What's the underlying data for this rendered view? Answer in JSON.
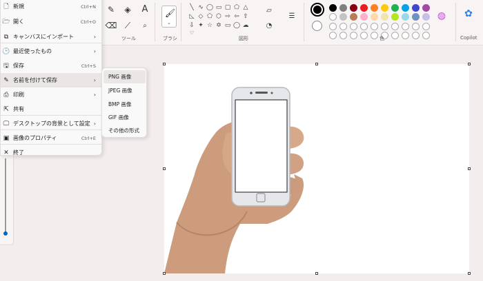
{
  "file_menu": {
    "items": [
      {
        "label": "新規",
        "shortcut": "Ctrl+N",
        "icon": "new-file-icon",
        "glyph": "🗋"
      },
      {
        "label": "開く",
        "shortcut": "Ctrl+O",
        "icon": "folder-open-icon",
        "glyph": "🗁"
      },
      {
        "label": "キャンバスにインポート",
        "shortcut": "",
        "arrow": "›",
        "icon": "import-icon",
        "glyph": "⧉"
      },
      {
        "label": "最近使ったもの",
        "shortcut": "",
        "arrow": "›",
        "icon": "clock-icon",
        "glyph": "🕒"
      },
      {
        "label": "保存",
        "shortcut": "Ctrl+S",
        "icon": "save-icon",
        "glyph": "🖫"
      },
      {
        "label": "名前を付けて保存",
        "shortcut": "",
        "arrow": "›",
        "icon": "save-as-icon",
        "glyph": "✎"
      },
      {
        "label": "印刷",
        "shortcut": "",
        "arrow": "›",
        "icon": "print-icon",
        "glyph": "⎙"
      },
      {
        "label": "共有",
        "shortcut": "",
        "icon": "share-icon",
        "glyph": "⇱"
      },
      {
        "label": "デスクトップの背景として設定",
        "shortcut": "",
        "arrow": "›",
        "icon": "desktop-icon",
        "glyph": "🖵"
      },
      {
        "label": "画像のプロパティ",
        "shortcut": "Ctrl+E",
        "icon": "properties-icon",
        "glyph": "▣"
      },
      {
        "label": "終了",
        "shortcut": "",
        "icon": "close-icon",
        "glyph": "✕"
      }
    ]
  },
  "save_as_submenu": [
    "PNG 画像",
    "JPEG 画像",
    "BMP 画像",
    "GIF 画像",
    "その他の形式"
  ],
  "ribbon": {
    "tools_label": "ツール",
    "brush_label": "ブラシ",
    "shapes_label": "図形",
    "colors_label": "色",
    "copilot_label": "Copilot"
  },
  "colors": {
    "primary": "#000000",
    "secondary": "#ffffff",
    "palette_row1": [
      "#000000",
      "#7f7f7f",
      "#880015",
      "#ed1c24",
      "#ff7f27",
      "#ffc90e",
      "#22b14c",
      "#00a2e8",
      "#3f48cc",
      "#a349a4"
    ],
    "palette_row2": [
      "#ffffff",
      "#c3c3c3",
      "#b97a57",
      "#ffaec9",
      "#ffd8a8",
      "#efe4b0",
      "#b5e61d",
      "#99d9ea",
      "#7092be",
      "#c8bfe7"
    ]
  },
  "accent": "#0067c0"
}
